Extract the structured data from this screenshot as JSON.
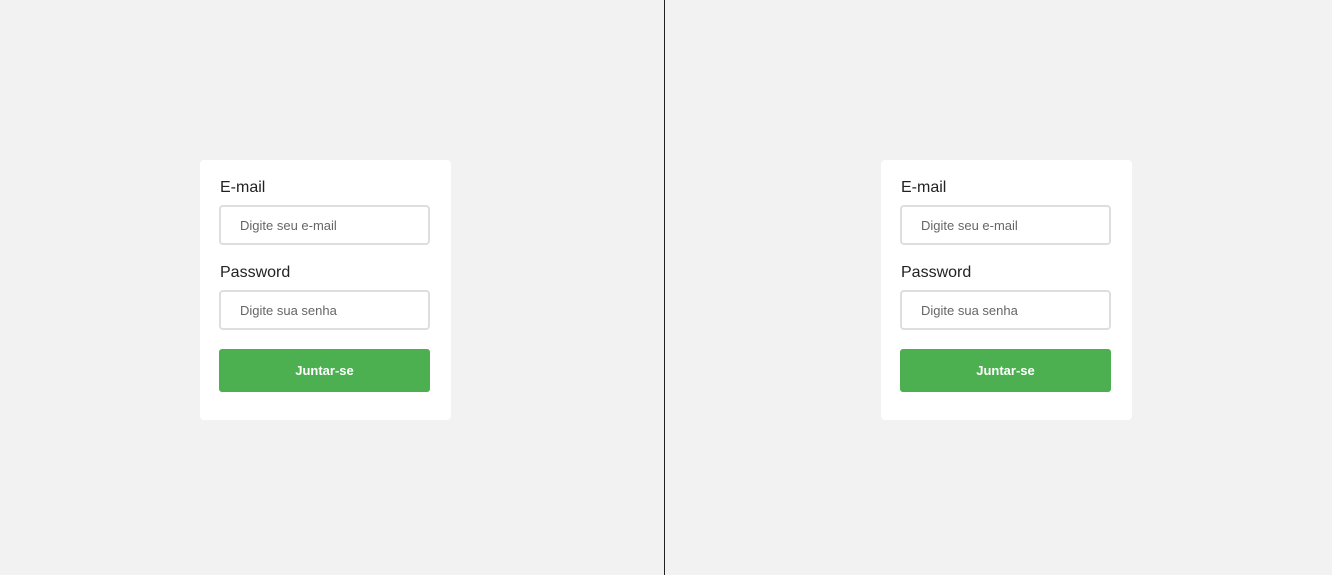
{
  "panes": [
    {
      "form": {
        "email_label": "E-mail",
        "email_placeholder": "Digite seu e-mail",
        "password_label": "Password",
        "password_placeholder": "Digite sua senha",
        "submit_label": "Juntar-se"
      }
    },
    {
      "form": {
        "email_label": "E-mail",
        "email_placeholder": "Digite seu e-mail",
        "password_label": "Password",
        "password_placeholder": "Digite sua senha",
        "submit_label": "Juntar-se"
      }
    }
  ],
  "colors": {
    "background": "#f2f2f2",
    "card": "#ffffff",
    "button": "#4caf50",
    "divider": "#222222"
  }
}
